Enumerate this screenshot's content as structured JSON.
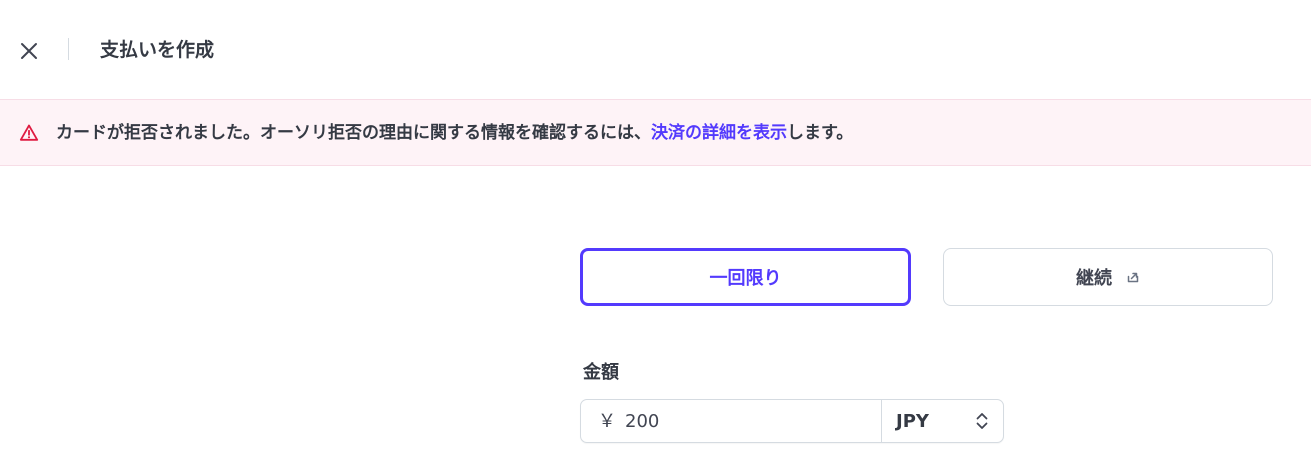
{
  "header": {
    "title": "支払いを作成",
    "close_icon": "close-icon"
  },
  "banner": {
    "icon": "warning-triangle-icon",
    "icon_color": "#df1b41",
    "text_before": "カードが拒否されました。オーソリ拒否の理由に関する情報を確認するには、",
    "link_text": "決済の詳細を表示",
    "text_after": "します。"
  },
  "payment_type": {
    "one_time_label": "一回限り",
    "recurring_label": "継続",
    "recurring_icon": "external-link-icon",
    "selected": "一回限り"
  },
  "amount": {
    "label": "金額",
    "currency_symbol": "￥",
    "value": "200",
    "currency": "JPY",
    "currency_icon": "chevron-updown-icon"
  },
  "colors": {
    "accent": "#533afd",
    "banner_bg": "#fef3f7",
    "warning": "#df1b41"
  }
}
